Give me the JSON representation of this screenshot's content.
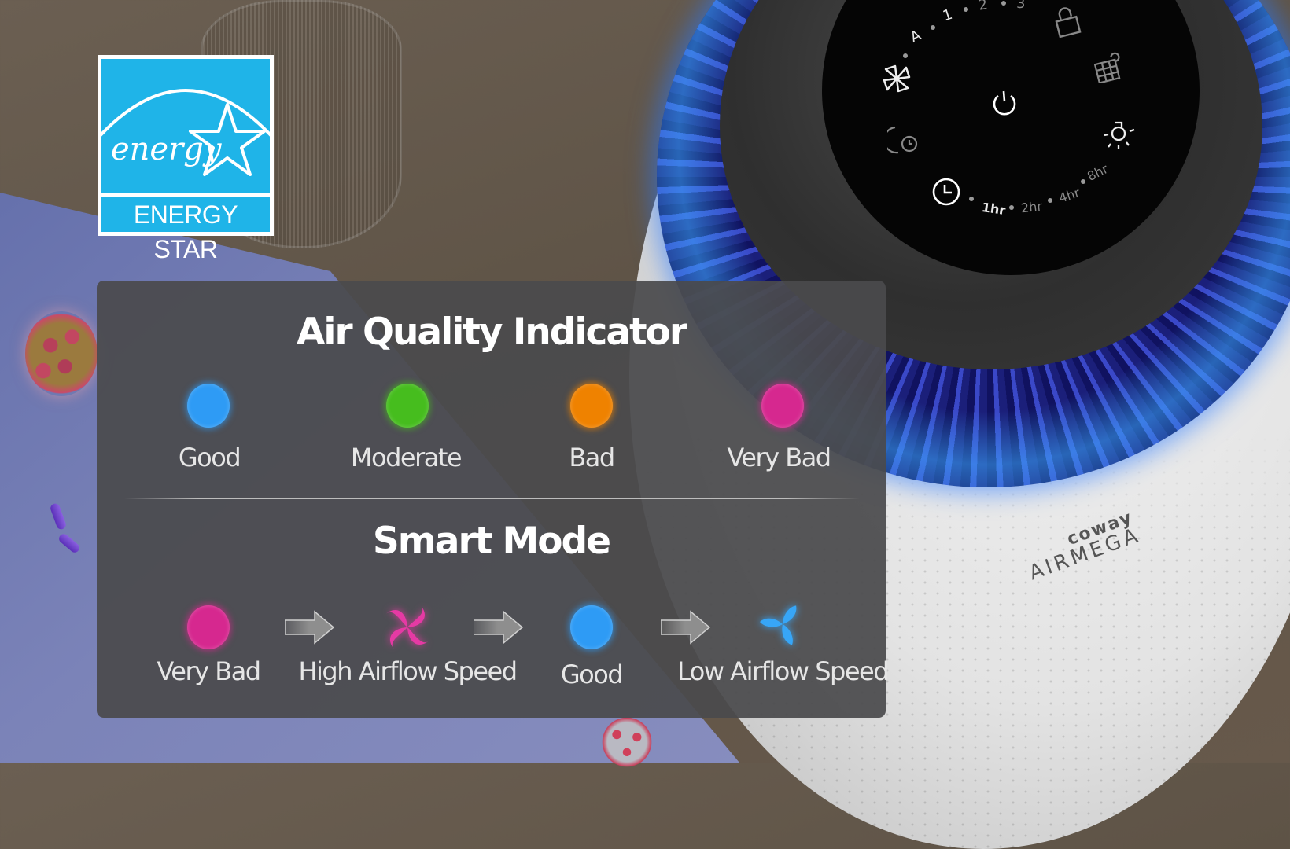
{
  "badge": {
    "name": "ENERGY STAR",
    "script_text": "energy",
    "color": "#1fb4e8"
  },
  "product": {
    "brand": "coway",
    "model": "AIRMEGA",
    "control_panel": {
      "fan_speed_labels": [
        "A",
        "1",
        "2",
        "3"
      ],
      "timer_labels": [
        "1hr",
        "2hr",
        "4hr",
        "8hr"
      ],
      "icons": [
        "fan-mode-icon",
        "power-icon",
        "lock-icon",
        "filter-reset-icon",
        "light-icon",
        "sleep-timer-icon",
        "timer-icon"
      ]
    }
  },
  "panel": {
    "air_quality": {
      "title": "Air Quality Indicator",
      "levels": [
        {
          "label": "Good",
          "color": "#2e9bf5"
        },
        {
          "label": "Moderate",
          "color": "#46bd1e"
        },
        {
          "label": "Bad",
          "color": "#ef8200"
        },
        {
          "label": "Very Bad",
          "color": "#d6288f"
        }
      ]
    },
    "smart_mode": {
      "title": "Smart Mode",
      "steps": [
        {
          "label": "Very Bad",
          "icon": "status-dot",
          "color": "#d6288f"
        },
        {
          "label": "High Airflow Speed",
          "icon": "fan-high-icon",
          "color": "#e53aa4"
        },
        {
          "label": "Good",
          "icon": "status-dot",
          "color": "#2e9bf5"
        },
        {
          "label": "Low Airflow Speed",
          "icon": "fan-low-icon",
          "color": "#37a6f7"
        }
      ]
    }
  }
}
